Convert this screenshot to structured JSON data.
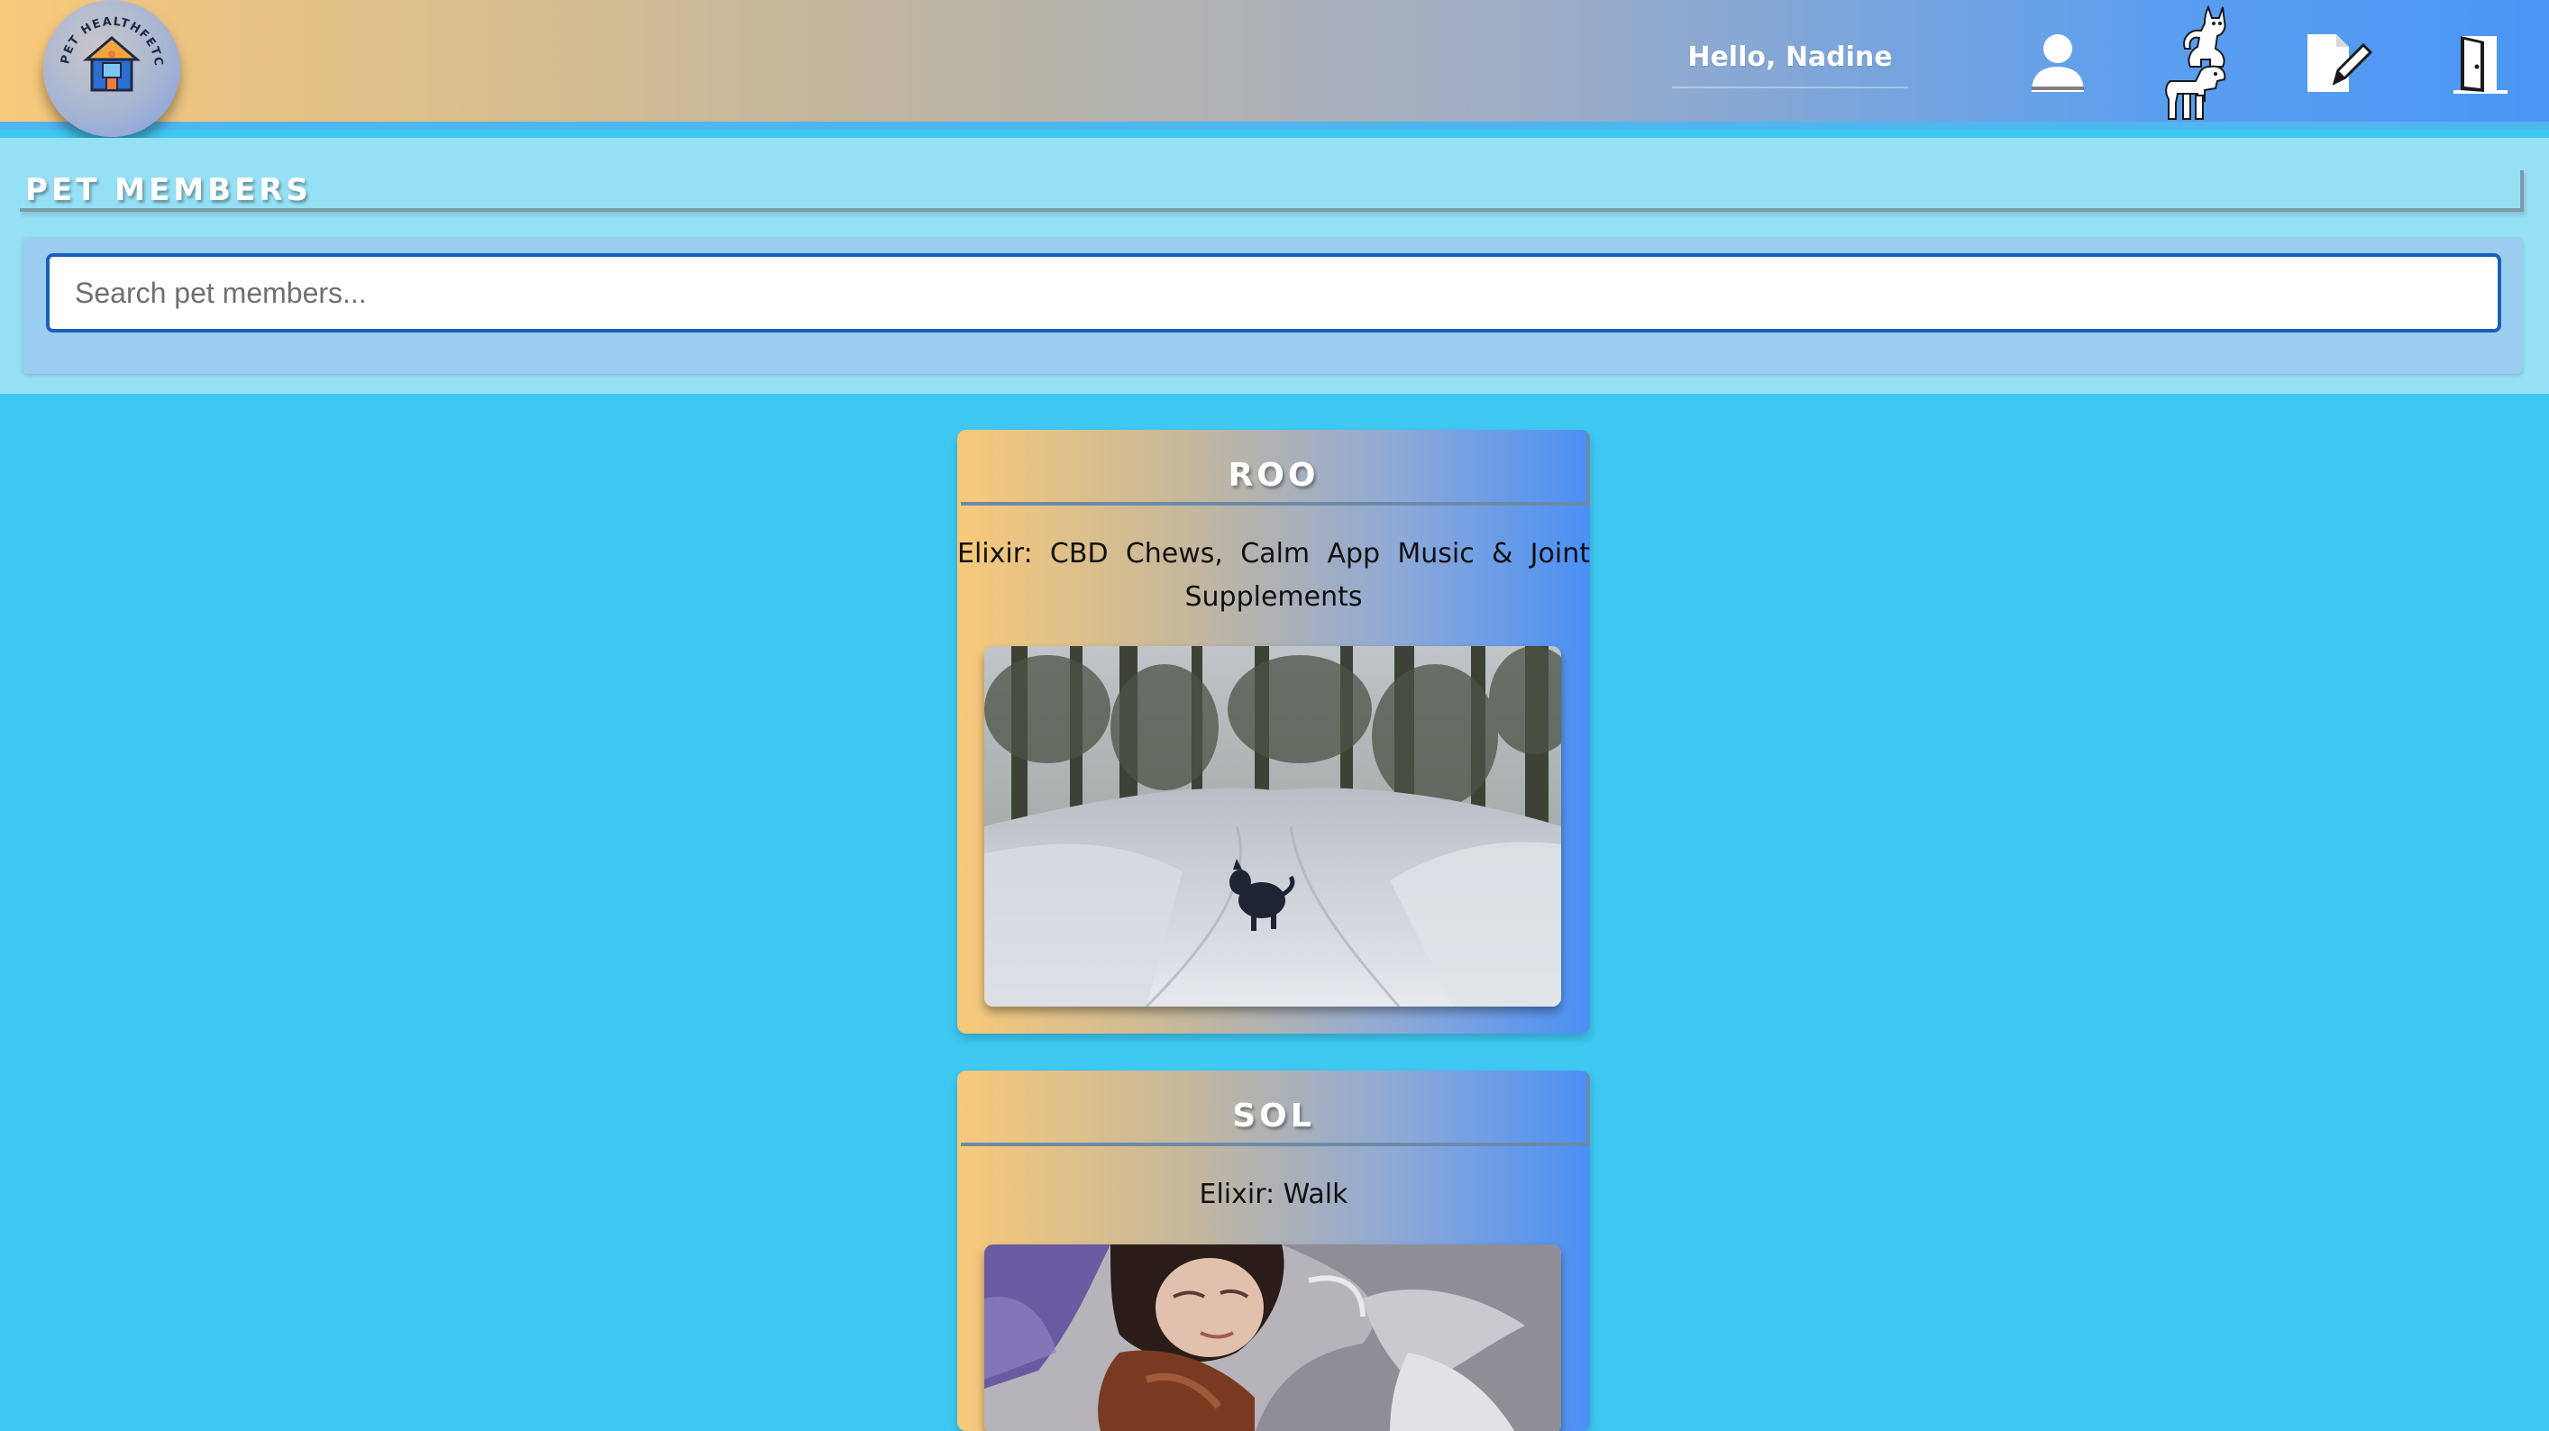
{
  "header": {
    "logo_text": "PET HEALTHFETCH",
    "greeting": "Hello, Nadine",
    "nav": [
      {
        "name": "profile",
        "icon": "user-icon"
      },
      {
        "name": "pets",
        "icon": "cat-dog-icon"
      },
      {
        "name": "edit",
        "icon": "edit-document-icon"
      },
      {
        "name": "logout",
        "icon": "door-exit-icon"
      }
    ]
  },
  "members": {
    "title": "PET MEMBERS",
    "search_placeholder": "Search pet members...",
    "search_value": ""
  },
  "pets": [
    {
      "name": "ROO",
      "elixir": "Elixir: CBD Chews, Calm App Music & Joint Supplements",
      "photo": "dog-in-snowy-forest"
    },
    {
      "name": "SOL",
      "elixir": "Elixir: Walk",
      "photo": "person-resting-with-pet"
    }
  ],
  "colors": {
    "page_background": "#3ec8f2",
    "panel_background": "#96e0f5",
    "search_border": "#1b5fb8",
    "gradient_start": "#f8c97a",
    "gradient_end": "#4a95f5"
  }
}
